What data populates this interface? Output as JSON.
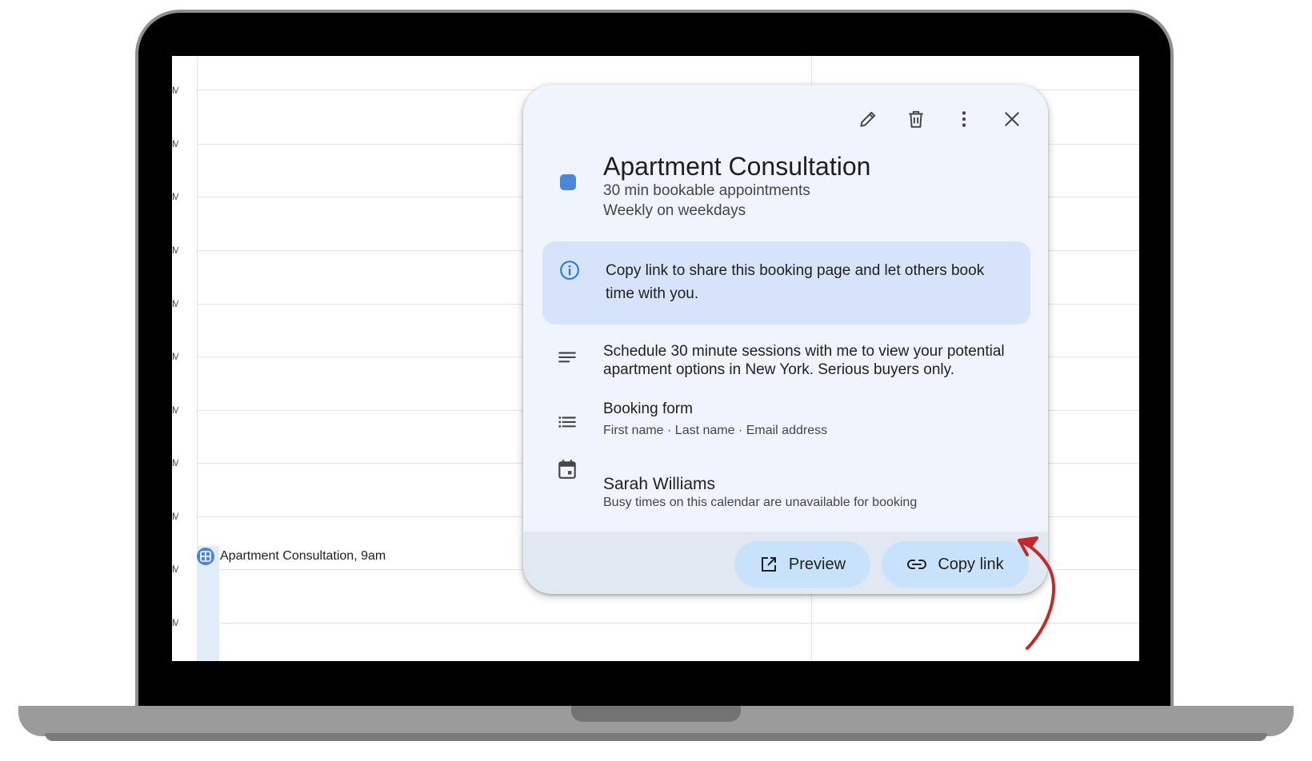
{
  "calendar": {
    "hour_tick": "M",
    "event_chip": {
      "name": "Apartment Consultation",
      "time": ", 9am"
    }
  },
  "popup": {
    "toolbar": {
      "edit_icon": "pencil-icon",
      "delete_icon": "trash-icon",
      "more_icon": "more-vertical-icon",
      "close_icon": "close-icon"
    },
    "color": "#4a86db",
    "title": "Apartment Consultation",
    "subtitle_duration": "30 min bookable appointments",
    "subtitle_recurrence": "Weekly on weekdays",
    "info_text": "Copy link to share this booking page and let others book time with you.",
    "description": "Schedule 30 minute sessions with me to view your potential apartment options in New York. Serious buyers only.",
    "booking_form": {
      "title": "Booking form",
      "fields": "First name · Last name · Email address"
    },
    "calendar_owner": {
      "name": "Sarah Williams",
      "note": "Busy times on this calendar are unavailable for booking"
    },
    "buttons": {
      "preview": "Preview",
      "copy_link": "Copy link"
    }
  },
  "annotation": {
    "arrow_color": "#c62828"
  }
}
